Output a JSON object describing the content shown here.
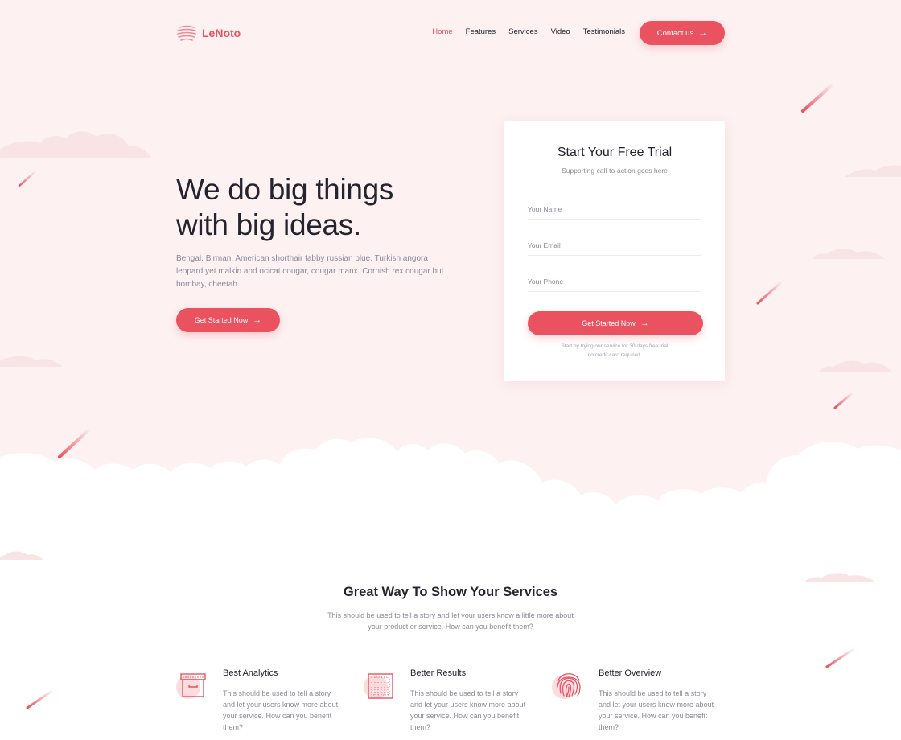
{
  "brand": {
    "name": "LeNoto",
    "accent": "#ea5260",
    "background": "#fdf1f2"
  },
  "nav": {
    "items": [
      {
        "label": "Home",
        "active": true
      },
      {
        "label": "Features",
        "active": false
      },
      {
        "label": "Services",
        "active": false
      },
      {
        "label": "Video",
        "active": false
      },
      {
        "label": "Testimonials",
        "active": false
      }
    ],
    "contact_label": "Contact us",
    "arrow_icon": "arrow-right-icon"
  },
  "hero": {
    "title_line1": "We do big things",
    "title_line2": "with big ideas.",
    "description": "Bengal. Birman. American shorthair tabby russian blue. Turkish angora leopard yet malkin and ocicat cougar, cougar manx. Cornish rex cougar but bombay, cheetah.",
    "cta_label": "Get Started Now"
  },
  "trial_form": {
    "title": "Start Your Free Trial",
    "subtitle": "Supporting call-to-action goes here",
    "name_placeholder": "Your Name",
    "email_placeholder": "Your Email",
    "phone_placeholder": "Your Phone",
    "submit_label": "Get Started Now",
    "note_line1": "Start by trying our service for 30 days free trial",
    "note_line2": "no credit card required."
  },
  "services": {
    "title": "Great Way To Show Your Services",
    "subtitle": "This should be used to tell a story and let your users know a little more about your product or service. How can you benefit them?",
    "items": [
      {
        "icon": "archive-box-icon",
        "title": "Best Analytics",
        "text": "This should be used to tell a story and let your users know more about your service. How can you benefit them?"
      },
      {
        "icon": "grid-square-icon",
        "title": "Better Results",
        "text": "This should be used to tell a story and let your users know more about your service. How can you benefit them?"
      },
      {
        "icon": "fingerprint-icon",
        "title": "Better Overview",
        "text": "This should be used to tell a story and let your users know more about your service. How can you benefit them?"
      }
    ]
  }
}
